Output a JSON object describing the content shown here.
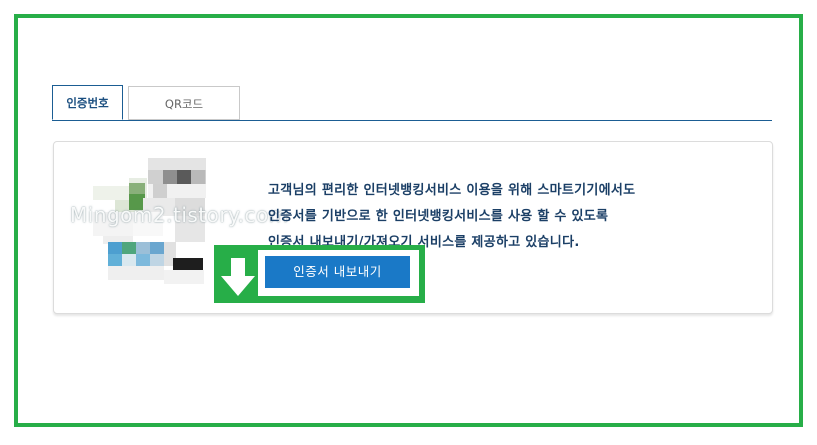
{
  "tabs": [
    {
      "label": "인증번호",
      "active": true
    },
    {
      "label": "QR코드",
      "active": false
    }
  ],
  "panel": {
    "description_lines": [
      "고객님의 편리한 인터넷뱅킹서비스 이용을 위해 스마트기기에서도",
      "인증서를 기반으로 한 인터넷뱅킹서비스를 사용 할 수 있도록",
      "인증서 내보내기/가져오기 서비스를 제공하고 있습니다."
    ],
    "export_button_label": "인증서 내보내기",
    "image_icon": "pixelated-phone-illustration"
  },
  "watermark": "Mingom2.tistory.com",
  "annotation": {
    "highlight_color": "#27ae48",
    "arrow_icon": "down-arrow-icon"
  },
  "colors": {
    "tab_active_text": "#1b4f80",
    "tab_border": "#1b5d93",
    "description_text": "#1b3f66",
    "button_bg": "#1a79c7"
  }
}
